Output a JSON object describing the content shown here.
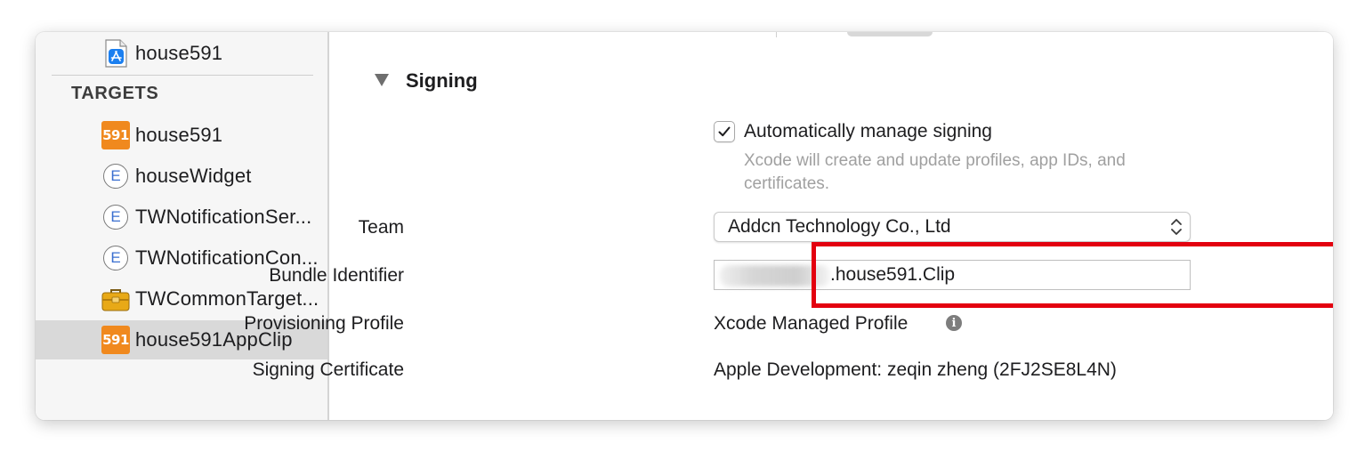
{
  "sidebar": {
    "project_item": {
      "label": "house591",
      "icon": "app-store-project-icon"
    },
    "targets_header": "TARGETS",
    "targets": [
      {
        "label": "house591",
        "icon": "591-app-icon",
        "icon_text": "591"
      },
      {
        "label": "houseWidget",
        "icon": "extension-icon",
        "icon_text": "E"
      },
      {
        "label": "TWNotificationSer...",
        "icon": "extension-icon",
        "icon_text": "E"
      },
      {
        "label": "TWNotificationCon...",
        "icon": "extension-icon",
        "icon_text": "E"
      },
      {
        "label": "TWCommonTarget...",
        "icon": "toolbox-icon"
      },
      {
        "label": "house591AppClip",
        "icon": "591-app-icon",
        "icon_text": "591",
        "selected": true
      }
    ]
  },
  "signing": {
    "section_title": "Signing",
    "auto_manage_label": "Automatically manage signing",
    "auto_manage_checked": true,
    "auto_manage_help": "Xcode will create and update profiles, app IDs, and certificates.",
    "team_label": "Team",
    "team_value": "Addcn Technology Co., Ltd",
    "bundle_id_label": "Bundle Identifier",
    "bundle_id_visible": ".house591.Clip",
    "provisioning_label": "Provisioning Profile",
    "provisioning_value": "Xcode Managed Profile",
    "certificate_label": "Signing Certificate",
    "certificate_value": "Apple Development: zeqin zheng (2FJ2SE8L4N)"
  },
  "colors": {
    "highlight_border": "#e3000f",
    "icon_591": "#f0891e",
    "selected_row": "#d9d9d9"
  }
}
